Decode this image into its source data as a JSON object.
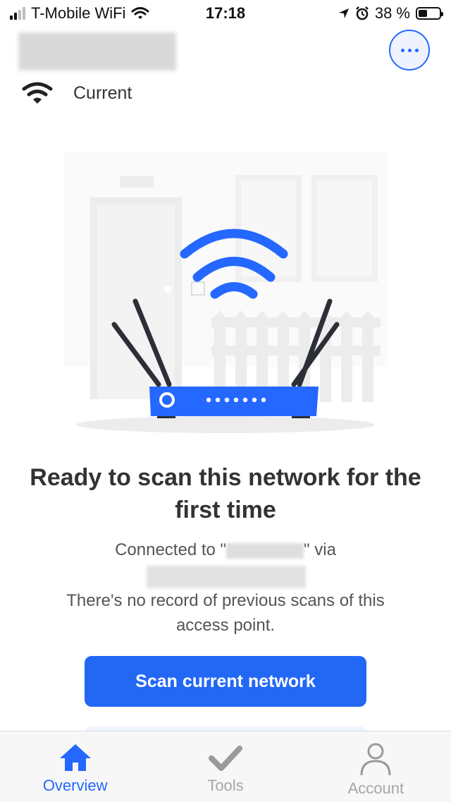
{
  "status_bar": {
    "carrier": "T-Mobile WiFi",
    "time": "17:18",
    "battery_percent": "38 %",
    "battery_level": 0.38
  },
  "header": {
    "current_label": "Current",
    "more_icon": "ellipsis-icon"
  },
  "main": {
    "headline": "Ready to scan this network for the first time",
    "connected_prefix": "Connected to \"",
    "connected_suffix": "\" via",
    "no_record": "There's no record of previous scans of this access point.",
    "scan_button": "Scan current network"
  },
  "tabs": [
    {
      "label": "Overview",
      "icon": "home-icon",
      "active": true
    },
    {
      "label": "Tools",
      "icon": "checkmark-icon",
      "active": false
    },
    {
      "label": "Account",
      "icon": "person-icon",
      "active": false
    }
  ],
  "colors": {
    "accent": "#2468ff",
    "button": "#2268f5",
    "inactive": "#a6a6a6"
  }
}
